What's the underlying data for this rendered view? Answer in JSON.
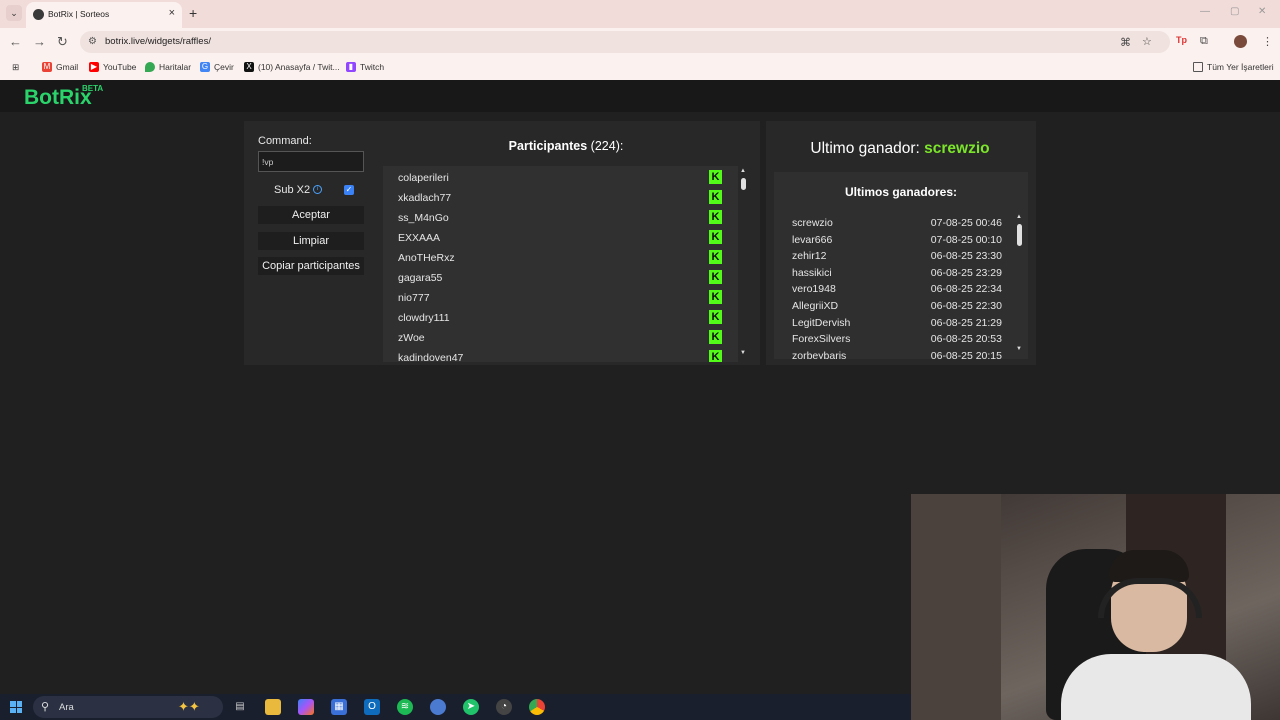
{
  "browser": {
    "tab_title": "BotRix | Sorteos",
    "url": "botrix.live/widgets/raffles/",
    "bookmarks": [
      "Gmail",
      "YouTube",
      "Haritalar",
      "Çevir",
      "(10) Anasayfa / Twit...",
      "Twitch"
    ],
    "all_bookmarks": "Tüm Yer İşaretleri"
  },
  "site": {
    "logo": "BotRix",
    "logo_badge": "BETA"
  },
  "controls": {
    "command_label": "Command:",
    "command_value": "!vp",
    "sub_label": "Sub X2",
    "sub_checked": true,
    "accept": "Aceptar",
    "clear": "Limpiar",
    "copy": "Copiar participantes"
  },
  "participants": {
    "title": "Participantes",
    "count": "(224):",
    "list": [
      "colaperileri",
      "xkadlach77",
      "ss_M4nGo",
      "EXXAAA",
      "AnoTHeRxz",
      "gagara55",
      "nio777",
      "clowdry111",
      "zWoe",
      "kadindoven47"
    ]
  },
  "winner": {
    "label": "Ultimo ganador:",
    "name": "screwzio"
  },
  "winners": {
    "title": "Ultimos ganadores:",
    "list": [
      {
        "name": "screwzio",
        "date": "07-08-25 00:46"
      },
      {
        "name": "levar666",
        "date": "07-08-25 00:10"
      },
      {
        "name": "zehir12",
        "date": "06-08-25 23:30"
      },
      {
        "name": "hassikici",
        "date": "06-08-25 23:29"
      },
      {
        "name": "vero1948",
        "date": "06-08-25 22:34"
      },
      {
        "name": "AllegriiXD",
        "date": "06-08-25 22:30"
      },
      {
        "name": "LegitDervish",
        "date": "06-08-25 21:29"
      },
      {
        "name": "ForexSilvers",
        "date": "06-08-25 20:53"
      },
      {
        "name": "zorbeybaris",
        "date": "06-08-25 20:15"
      }
    ]
  },
  "taskbar": {
    "search_placeholder": "Ara"
  }
}
